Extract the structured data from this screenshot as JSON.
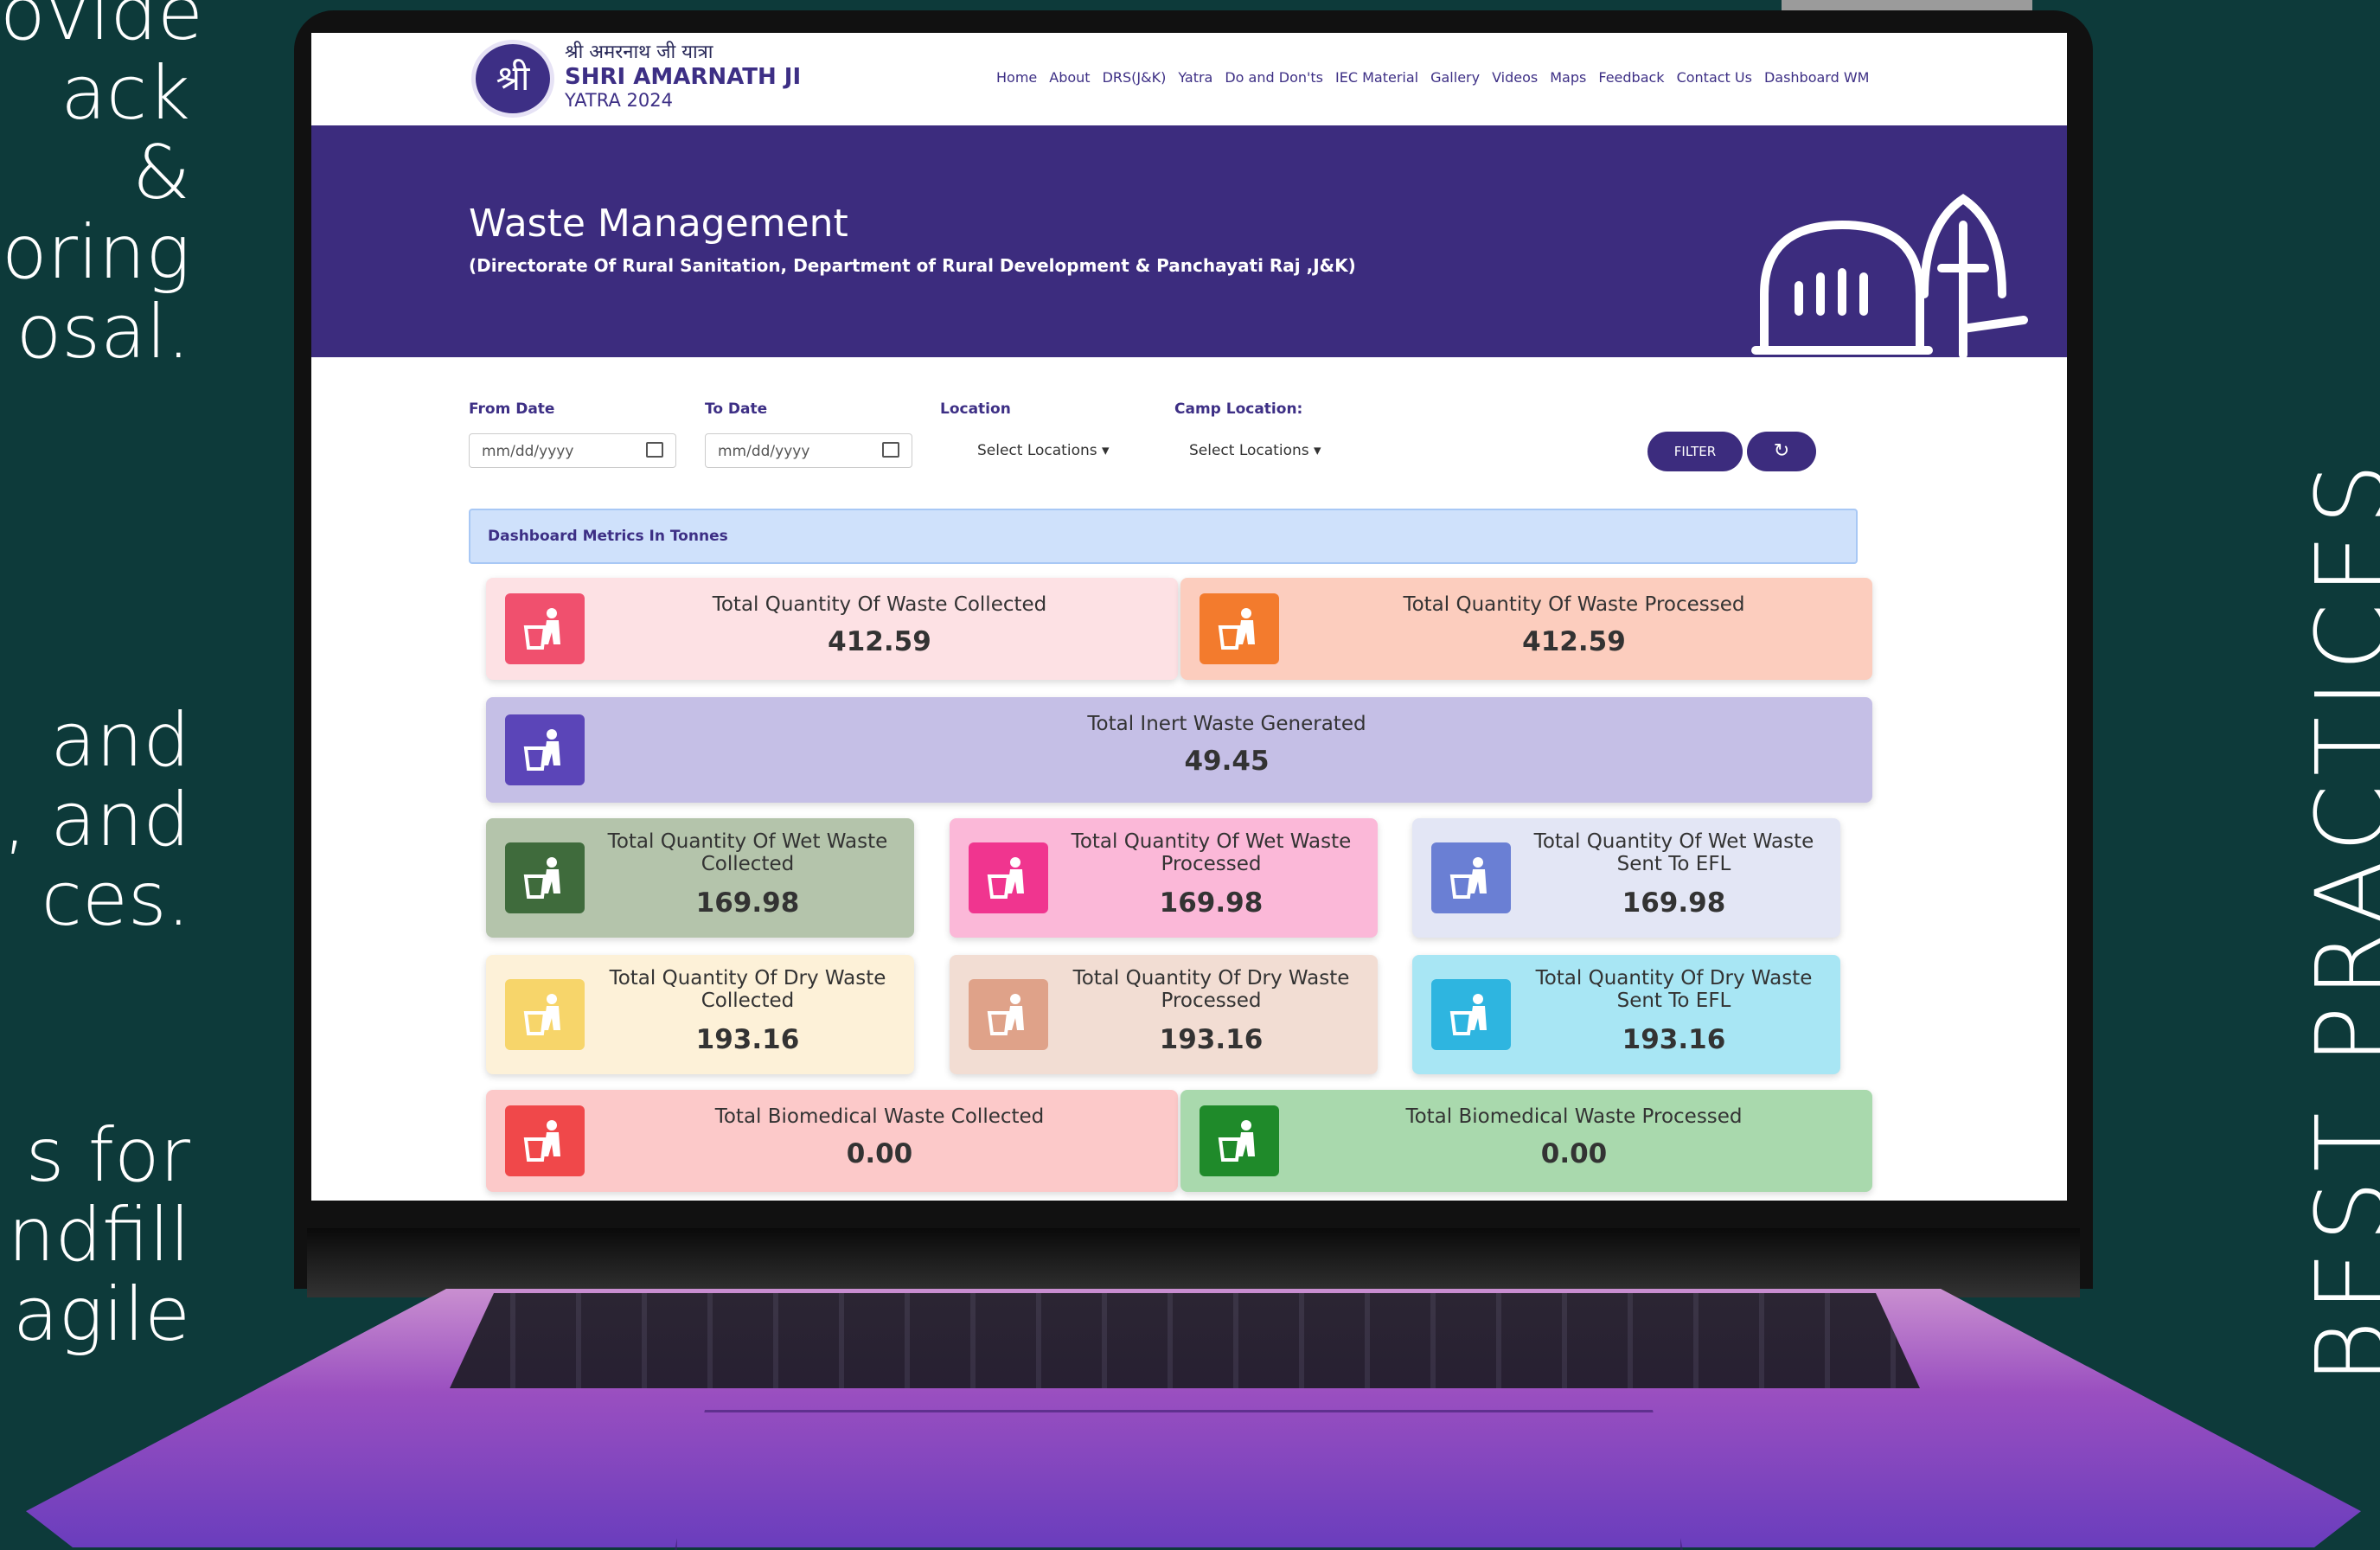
{
  "slide": {
    "left_text_1": [
      "ovide",
      "ack &",
      "oring",
      "osal."
    ],
    "left_text_2": [
      "and",
      ", and",
      "ces."
    ],
    "left_text_3": [
      "s  for",
      "ndfill",
      "agile"
    ],
    "vertical_title": "BEST PRACTICES"
  },
  "site": {
    "logo_text": "श्री",
    "brand_hindi": "श्री अमरनाथ जी यात्रा",
    "brand_name": "SHRI AMARNATH JI",
    "brand_year": "YATRA 2024",
    "nav": [
      "Home",
      "About",
      "DRS(J&K)",
      "Yatra",
      "Do and Don'ts",
      "IEC Material",
      "Gallery",
      "Videos",
      "Maps",
      "Feedback",
      "Contact Us",
      "Dashboard WM"
    ]
  },
  "banner": {
    "title": "Waste Management",
    "subtitle": "(Directorate Of Rural Sanitation, Department of Rural Development & Panchayati Raj ,J&K)",
    "art": "shrine-trident-icon"
  },
  "filters": {
    "from_label": "From Date",
    "from_placeholder": "mm/dd/yyyy",
    "to_label": "To Date",
    "to_placeholder": "mm/dd/yyyy",
    "location_label": "Location",
    "location_value": "Select Locations ▾",
    "camp_label": "Camp Location:",
    "camp_value": "Select Locations ▾",
    "filter_button": "FILTER",
    "refresh_icon": "↻"
  },
  "metrics_title": "Dashboard Metrics In Tonnes",
  "cards": [
    {
      "label": "Total Quantity Of Waste Collected",
      "value": "412.59",
      "bg": "#fde1e4",
      "icon_bg": "#f0506e"
    },
    {
      "label": "Total Quantity Of Waste Processed",
      "value": "412.59",
      "bg": "#fccdbe",
      "icon_bg": "#f37b2d"
    },
    {
      "label": "Total Inert Waste Generated",
      "value": "49.45",
      "bg": "#c5bfe6",
      "icon_bg": "#5b45b8"
    },
    {
      "label": "Total Quantity Of Wet Waste Collected",
      "value": "169.98",
      "bg": "#b4c4ab",
      "icon_bg": "#3f6b3c"
    },
    {
      "label": "Total Quantity Of Wet Waste Processed",
      "value": "169.98",
      "bg": "#fbb8d8",
      "icon_bg": "#f0358f"
    },
    {
      "label": "Total Quantity Of Wet Waste Sent To EFL",
      "value": "169.98",
      "bg": "#e3e6f5",
      "icon_bg": "#6a7fd4"
    },
    {
      "label": "Total Quantity Of Dry Waste Collected",
      "value": "193.16",
      "bg": "#fdf1d8",
      "icon_bg": "#f7d56a"
    },
    {
      "label": "Total Quantity Of Dry Waste Processed",
      "value": "193.16",
      "bg": "#f2ddd3",
      "icon_bg": "#dfa289"
    },
    {
      "label": "Total Quantity Of Dry Waste Sent To EFL",
      "value": "193.16",
      "bg": "#a8e6f4",
      "icon_bg": "#2eb5e0"
    },
    {
      "label": "Total Biomedical Waste Collected",
      "value": "0.00",
      "bg": "#fcc9c9",
      "icon_bg": "#f0484a"
    },
    {
      "label": "Total Biomedical Waste Processed",
      "value": "0.00",
      "bg": "#a9d9ad",
      "icon_bg": "#1f8a2a"
    }
  ]
}
